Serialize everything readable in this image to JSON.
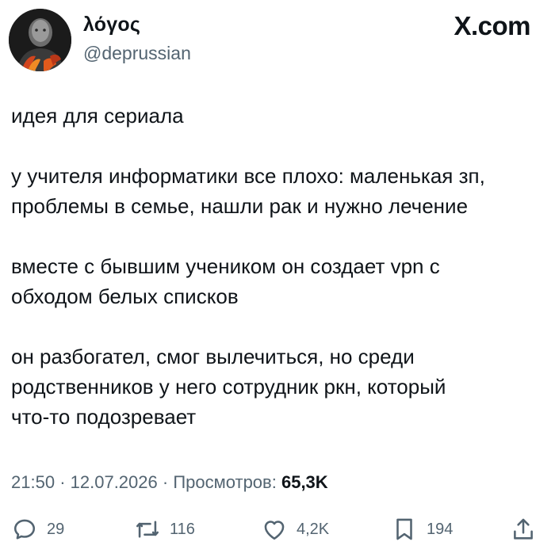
{
  "author": {
    "name": "λόγος",
    "handle": "@deprussian"
  },
  "brand": "X.com",
  "tweet": {
    "paragraphs": [
      "идея для сериала",
      "у учителя информатики все плохо: маленькая зп,\nпроблемы в семье, нашли рак и нужно лечение",
      "вместе с бывшим учеником он создает vpn с\nобходом белых списков",
      "он разбогател, смог вылечиться, но среди\nродственников у него сотрудник ркн, который\nчто-то подозревает"
    ]
  },
  "meta": {
    "time": "21:50",
    "date": "12.07.2026",
    "views_label": "Просмотров:",
    "views_count": "65,3K",
    "separator": "·"
  },
  "actions": {
    "replies": "29",
    "retweets": "116",
    "likes": "4,2K",
    "bookmarks": "194"
  },
  "icons": {
    "reply": "reply-icon",
    "retweet": "retweet-icon",
    "like": "heart-icon",
    "bookmark": "bookmark-icon",
    "share": "share-icon"
  },
  "colors": {
    "text": "#0f1419",
    "secondary": "#536471",
    "background": "#ffffff"
  }
}
